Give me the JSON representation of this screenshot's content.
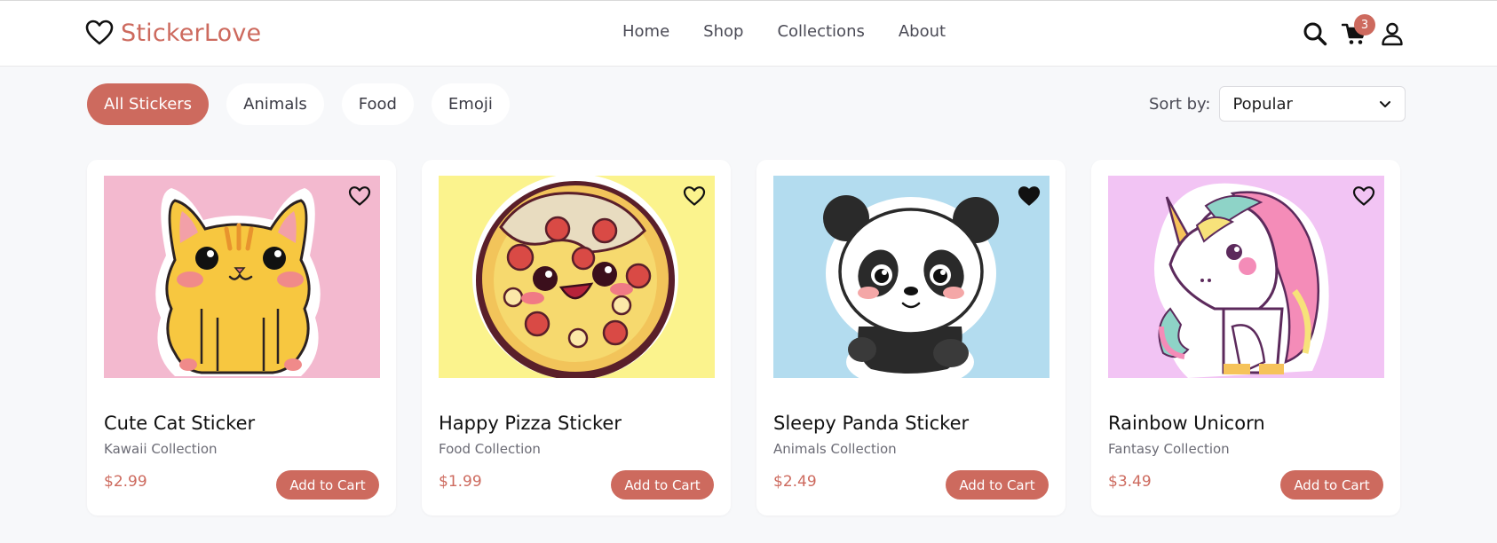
{
  "brand": {
    "name": "StickerLove",
    "accent": "#cd6a5e"
  },
  "nav": {
    "items": [
      "Home",
      "Shop",
      "Collections",
      "About"
    ]
  },
  "header_icons": {
    "search": "search-icon",
    "cart": "cart-icon",
    "user": "user-icon",
    "cart_count": "3"
  },
  "filters": {
    "chips": [
      {
        "label": "All Stickers",
        "active": true
      },
      {
        "label": "Animals",
        "active": false
      },
      {
        "label": "Food",
        "active": false
      },
      {
        "label": "Emoji",
        "active": false
      }
    ]
  },
  "sort": {
    "label": "Sort by:",
    "selected": "Popular"
  },
  "products": [
    {
      "name": "Cute Cat Sticker",
      "collection": "Kawaii Collection",
      "price": "$2.99",
      "button": "Add to Cart",
      "favorited": false,
      "image_bg": "#f3b9cf",
      "image": "cat sticker"
    },
    {
      "name": "Happy Pizza Sticker",
      "collection": "Food Collection",
      "price": "$1.99",
      "button": "Add to Cart",
      "favorited": false,
      "image_bg": "#fbf38d",
      "image": "pizza sticker"
    },
    {
      "name": "Sleepy Panda Sticker",
      "collection": "Animals Collection",
      "price": "$2.49",
      "button": "Add to Cart",
      "favorited": true,
      "image_bg": "#b3dcef",
      "image": "panda sticker"
    },
    {
      "name": "Rainbow Unicorn",
      "collection": "Fantasy Collection",
      "price": "$3.49",
      "button": "Add to Cart",
      "favorited": false,
      "image_bg": "#f2c4f4",
      "image": "unicorn sticker"
    }
  ]
}
